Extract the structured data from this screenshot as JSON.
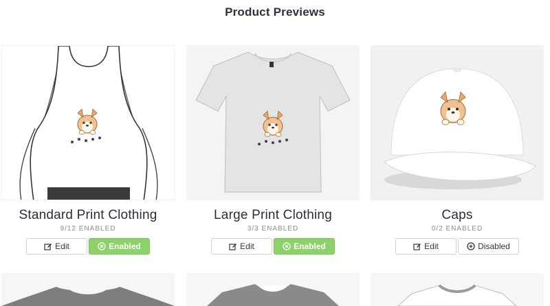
{
  "page": {
    "title": "Product Previews"
  },
  "cards": [
    {
      "title": "Standard Print Clothing",
      "status": "9/12 ENABLED",
      "edit_label": "Edit",
      "toggle_label": "Enabled",
      "toggle_state": "enabled",
      "preview": "white-tank-top-corgi"
    },
    {
      "title": "Large Print Clothing",
      "status": "3/3 ENABLED",
      "edit_label": "Edit",
      "toggle_label": "Enabled",
      "toggle_state": "enabled",
      "preview": "grey-tshirt-corgi"
    },
    {
      "title": "Caps",
      "status": "0/2 ENABLED",
      "edit_label": "Edit",
      "toggle_label": "Disabled",
      "toggle_state": "disabled",
      "preview": "white-cap-corgi"
    }
  ],
  "colors": {
    "enabled_green": "#8cd16a",
    "title_text": "#2f3140",
    "status_text": "#8a8c93"
  },
  "icons": {
    "edit": "pencil-square-icon",
    "enabled": "circle-x-icon",
    "disabled": "circle-plus-icon"
  }
}
